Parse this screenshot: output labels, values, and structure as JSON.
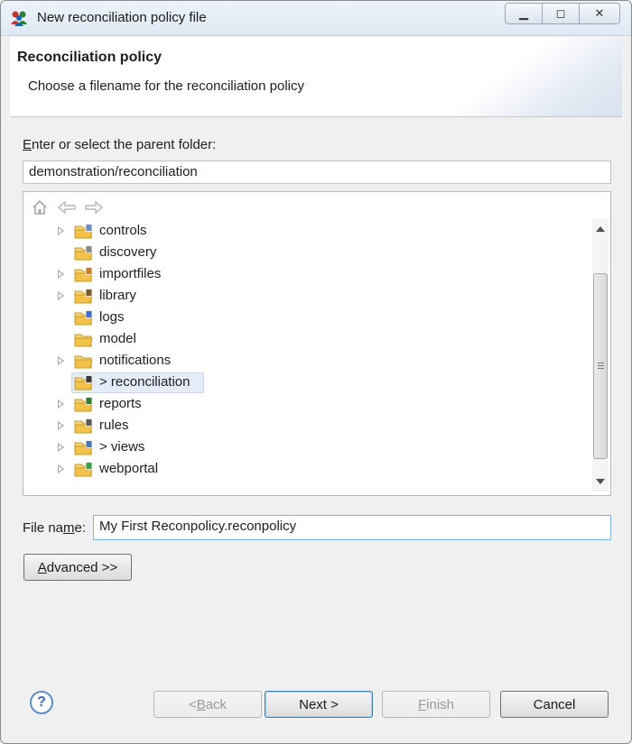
{
  "window": {
    "title": "New reconciliation policy file",
    "controls": {
      "minimize": "▁",
      "maximize": "◻",
      "close": "✕"
    }
  },
  "banner": {
    "title": "Reconciliation policy",
    "subtitle": "Choose a filename for the reconciliation policy"
  },
  "parent_folder": {
    "label_prefix": "E",
    "label_rest": "nter or select the parent folder:",
    "value": "demonstration/reconciliation"
  },
  "tree": {
    "nav_icons": [
      "home-icon",
      "back-arrow-icon",
      "forward-arrow-icon"
    ],
    "items": [
      {
        "label": "controls",
        "expandable": true,
        "selected": false,
        "icon": "folder-controls-icon"
      },
      {
        "label": "discovery",
        "expandable": false,
        "selected": false,
        "icon": "folder-discovery-icon"
      },
      {
        "label": "importfiles",
        "expandable": true,
        "selected": false,
        "icon": "folder-importfiles-icon"
      },
      {
        "label": "library",
        "expandable": true,
        "selected": false,
        "icon": "folder-library-icon"
      },
      {
        "label": "logs",
        "expandable": false,
        "selected": false,
        "icon": "folder-logs-icon"
      },
      {
        "label": "model",
        "expandable": false,
        "selected": false,
        "icon": "folder-icon"
      },
      {
        "label": "notifications",
        "expandable": true,
        "selected": false,
        "icon": "folder-icon"
      },
      {
        "label": "> reconciliation",
        "expandable": false,
        "selected": true,
        "icon": "folder-reconciliation-icon"
      },
      {
        "label": "reports",
        "expandable": true,
        "selected": false,
        "icon": "folder-reports-icon"
      },
      {
        "label": "rules",
        "expandable": true,
        "selected": false,
        "icon": "folder-rules-icon"
      },
      {
        "label": "> views",
        "expandable": true,
        "selected": false,
        "icon": "folder-views-icon"
      },
      {
        "label": "webportal",
        "expandable": true,
        "selected": false,
        "icon": "folder-webportal-icon"
      }
    ]
  },
  "file_name": {
    "label_a": "File na",
    "label_u": "m",
    "label_b": "e:",
    "value": "My First Reconpolicy.reconpolicy"
  },
  "advanced_button": {
    "u": "A",
    "rest": "dvanced >>"
  },
  "footer": {
    "help": "?",
    "back": {
      "pre": "< ",
      "u": "B",
      "rest": "ack"
    },
    "next": "Next >",
    "finish": {
      "u": "F",
      "rest": "inish"
    },
    "cancel": "Cancel"
  },
  "colors": {
    "selection": "#e5ecf7",
    "folder": "#f2c24a",
    "accent_border": "#7eb4ea"
  }
}
